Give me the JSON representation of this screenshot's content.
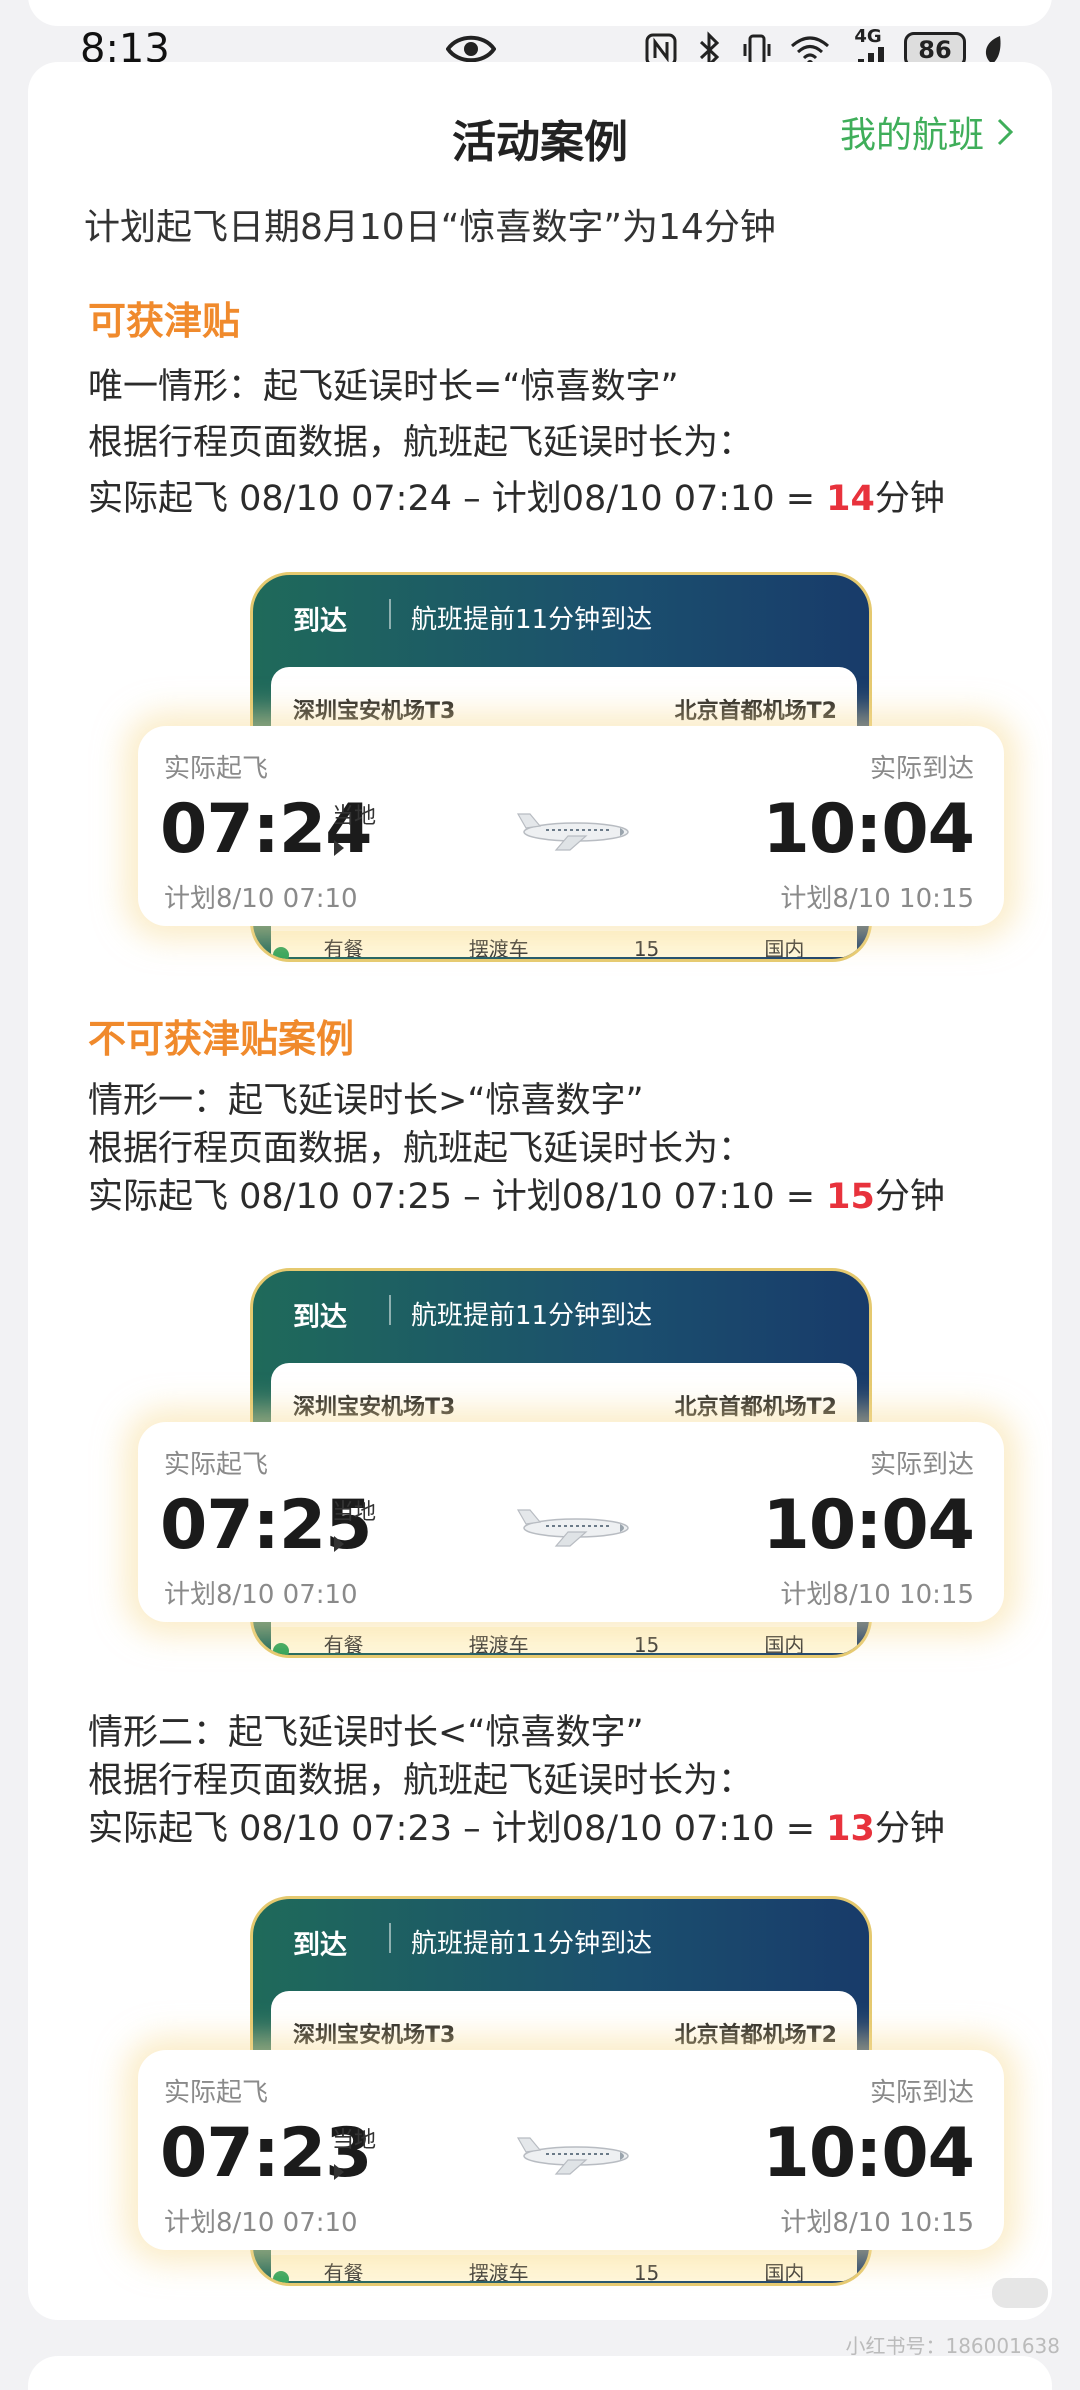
{
  "status_bar": {
    "time": "8:13",
    "network": "4G",
    "battery": "86"
  },
  "header": {
    "title": "活动案例",
    "my_flight_link": "我的航班"
  },
  "intro": "计划起飞日期8月10日“惊喜数字”为14分钟",
  "eligible": {
    "heading": "可获津贴",
    "line1": "唯一情形：起飞延误时长=“惊喜数字”",
    "line2": "根据行程页面数据，航班起飞延误时长为：",
    "line3_prefix": "实际起飞 08/10 07:24 – 计划08/10 07:10 = ",
    "line3_number": "14",
    "line3_suffix": "分钟"
  },
  "ineligible": {
    "heading": "不可获津贴案例",
    "case1": {
      "line1": "情形一：起飞延误时长>“惊喜数字”",
      "line2": "根据行程页面数据，航班起飞延误时长为：",
      "line3_prefix": "实际起飞 08/10 07:25 – 计划08/10 07:10 = ",
      "line3_number": "15",
      "line3_suffix": "分钟"
    },
    "case2": {
      "line1": "情形二：起飞延误时长<“惊喜数字”",
      "line2": "根据行程页面数据，航班起飞延误时长为：",
      "line3_prefix": "实际起飞 08/10 07:23 – 计划08/10 07:10 = ",
      "line3_number": "13",
      "line3_suffix": "分钟"
    }
  },
  "flight_cards": [
    {
      "arrive_label": "到达",
      "arrive_note": "航班提前11分钟到达",
      "origin": "深圳宝安机场T3",
      "destination": "北京首都机场T2",
      "dep_label": "实际起飞",
      "arr_label": "实际到达",
      "dep_time": "07:24",
      "local_label": "当地",
      "arr_time": "10:04",
      "dep_plan": "计划8/10 07:10",
      "arr_plan": "计划8/10 10:15",
      "bottom_items": [
        "有餐",
        "摆渡车",
        "15",
        "国内"
      ]
    },
    {
      "arrive_label": "到达",
      "arrive_note": "航班提前11分钟到达",
      "origin": "深圳宝安机场T3",
      "destination": "北京首都机场T2",
      "dep_label": "实际起飞",
      "arr_label": "实际到达",
      "dep_time": "07:25",
      "local_label": "当地",
      "arr_time": "10:04",
      "dep_plan": "计划8/10 07:10",
      "arr_plan": "计划8/10 10:15",
      "bottom_items": [
        "有餐",
        "摆渡车",
        "15",
        "国内"
      ]
    },
    {
      "arrive_label": "到达",
      "arrive_note": "航班提前11分钟到达",
      "origin": "深圳宝安机场T3",
      "destination": "北京首都机场T2",
      "dep_label": "实际起飞",
      "arr_label": "实际到达",
      "dep_time": "07:23",
      "local_label": "当地",
      "arr_time": "10:04",
      "dep_plan": "计划8/10 07:10",
      "arr_plan": "计划8/10 10:15",
      "bottom_items": [
        "有餐",
        "摆渡车",
        "15",
        "国内"
      ]
    }
  ],
  "watermark": "小红书号：186001638",
  "colors": {
    "accent_green": "#3fae5a",
    "heading_orange": "#f08a2c",
    "highlight_red": "#e8323c"
  }
}
